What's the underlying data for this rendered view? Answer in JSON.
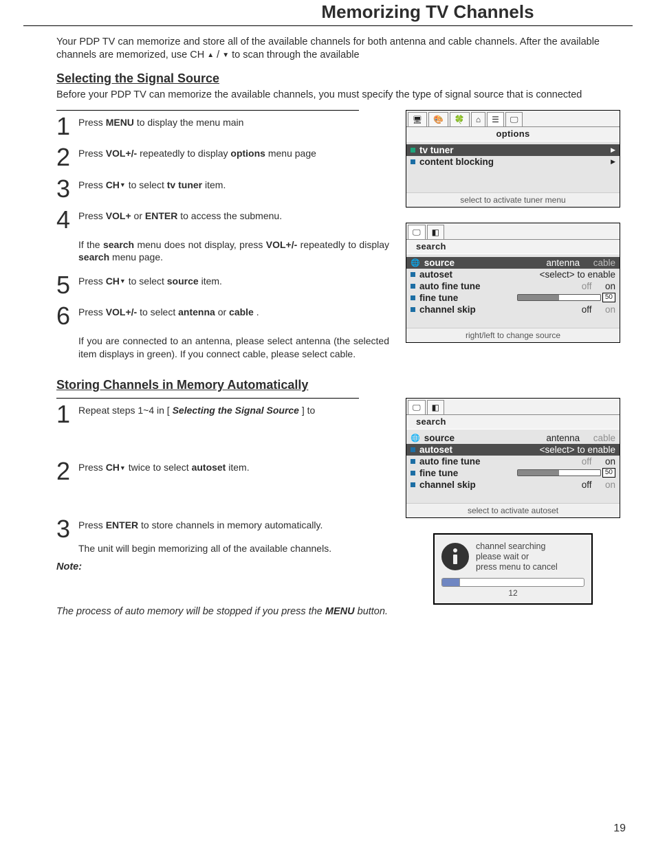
{
  "page": {
    "title": "Memorizing TV Channels",
    "number": "19"
  },
  "intro": {
    "p1a": "Your PDP TV can memorize and store all of the available channels for both antenna and cable channels. After the  available channels are memorized, use CH",
    "p1b": "to scan through the available"
  },
  "section1": {
    "heading": "Selecting the Signal Source",
    "sub": "Before your PDP TV can memorize the available channels, you must specify the type of signal source that is connected",
    "steps": {
      "s1": {
        "num": "1",
        "t1": "Press ",
        "b1": "MENU",
        "t2": " to display the menu main"
      },
      "s2": {
        "num": "2",
        "t1": "Press ",
        "b1": "VOL+/-",
        "t2": " repeatedly to display ",
        "b2": "options",
        "t3": " menu page"
      },
      "s3": {
        "num": "3",
        "t1": "Press ",
        "b1": "CH",
        "t2": " to select ",
        "b2": "tv tuner",
        "t3": " item."
      },
      "s4": {
        "num": "4",
        "t1": "Press ",
        "b1": "VOL+",
        "t2": " or ",
        "b2": "ENTER",
        "t3": " to access the submenu.",
        "extra1a": "If the ",
        "extra1b": "search",
        "extra1c": " menu does not display, press ",
        "extra1d": "VOL+/-",
        "extra1e": " repeatedly to display ",
        "extra1f": "search",
        "extra1g": " menu page."
      },
      "s5": {
        "num": "5",
        "t1": "Press ",
        "b1": "CH",
        "t2": " to select ",
        "b2": "source",
        "t3": " item."
      },
      "s6": {
        "num": "6",
        "t1": "Press ",
        "b1": "VOL+/-",
        "t2": " to select ",
        "b2": "antenna",
        "t3": " or ",
        "b3": "cable",
        "t4": ".",
        "extra": "If you are connected to an antenna, please select antenna (the selected item displays in green). If you connect cable, please select cable."
      }
    }
  },
  "section2": {
    "heading": "Storing Channels in Memory Automatically",
    "steps": {
      "s1": {
        "num": "1",
        "t1": "Repeat steps 1~4 in [",
        "b1": "Selecting the Signal Source",
        "t2": "] to"
      },
      "s2": {
        "num": "2",
        "t1": "Press ",
        "b1": "CH",
        "t2": " twice to select ",
        "b2": "autoset",
        "t3": " item."
      },
      "s3": {
        "num": "3",
        "t1": "Press ",
        "b1": "ENTER",
        "t2": " to store channels in memory automatically.",
        "extra": "The unit will begin memorizing all of the available channels."
      }
    },
    "note_label": "Note:",
    "note_body1": "The process of auto memory will be stopped if you press the ",
    "note_body_b": "MENU",
    "note_body2": " button."
  },
  "osd_options": {
    "caption": "options",
    "items": {
      "tv_tuner": "tv tuner",
      "content_blocking": "content blocking"
    },
    "hint": "select to activate tuner menu"
  },
  "osd_search1": {
    "tab": "search",
    "rows": {
      "source": {
        "label": "source",
        "v1": "antenna",
        "v2": "cable"
      },
      "autoset": {
        "label": "autoset",
        "v": "<select> to enable"
      },
      "aft": {
        "label": "auto fine tune",
        "v1": "off",
        "v2": "on"
      },
      "ft": {
        "label": "fine tune",
        "badge": "50"
      },
      "cs": {
        "label": "channel skip",
        "v1": "off",
        "v2": "on"
      }
    },
    "hint": "right/left to change source"
  },
  "osd_search2": {
    "tab": "search",
    "rows": {
      "source": {
        "label": "source",
        "v1": "antenna",
        "v2": "cable"
      },
      "autoset": {
        "label": "autoset",
        "v": "<select> to enable"
      },
      "aft": {
        "label": "auto fine tune",
        "v1": "off",
        "v2": "on"
      },
      "ft": {
        "label": "fine tune",
        "badge": "50"
      },
      "cs": {
        "label": "channel skip",
        "v1": "off",
        "v2": "on"
      }
    },
    "hint": "select to activate autoset"
  },
  "osd_popup": {
    "l1": "channel searching",
    "l2": "please wait or",
    "l3": "press menu to cancel",
    "num": "12"
  }
}
